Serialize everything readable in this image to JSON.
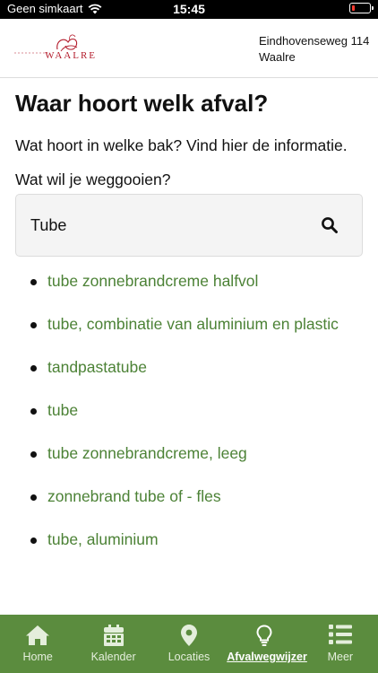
{
  "status_bar": {
    "carrier": "Geen simkaart",
    "time": "15:45",
    "battery_level": 0.15,
    "battery_color": "#ff3b30"
  },
  "header": {
    "logo_text": "WAALRE",
    "address_line1": "Eindhovenseweg 114",
    "address_line2": "Waalre"
  },
  "main": {
    "title": "Waar hoort welk afval?",
    "intro": "Wat hoort in welke bak? Vind hier de informatie.",
    "question": "Wat wil je weggooien?",
    "search": {
      "value": "Tube",
      "icon": "search-icon"
    },
    "results": [
      "tube zonnebrandcreme halfvol",
      "tube, combinatie van aluminium en plastic",
      "tandpastatube",
      "tube",
      "tube zonnebrandcreme, leeg",
      "zonnebrand tube of - fles",
      "tube, aluminium"
    ],
    "link_color": "#4c8236"
  },
  "tabbar": {
    "background": "#5b8c3e",
    "tabs": [
      {
        "label": "Home",
        "icon": "home-icon"
      },
      {
        "label": "Kalender",
        "icon": "calendar-icon"
      },
      {
        "label": "Locaties",
        "icon": "location-pin-icon"
      },
      {
        "label": "Afvalwegwijzer",
        "icon": "lightbulb-icon",
        "active": true
      },
      {
        "label": "Meer",
        "icon": "list-icon"
      }
    ]
  }
}
